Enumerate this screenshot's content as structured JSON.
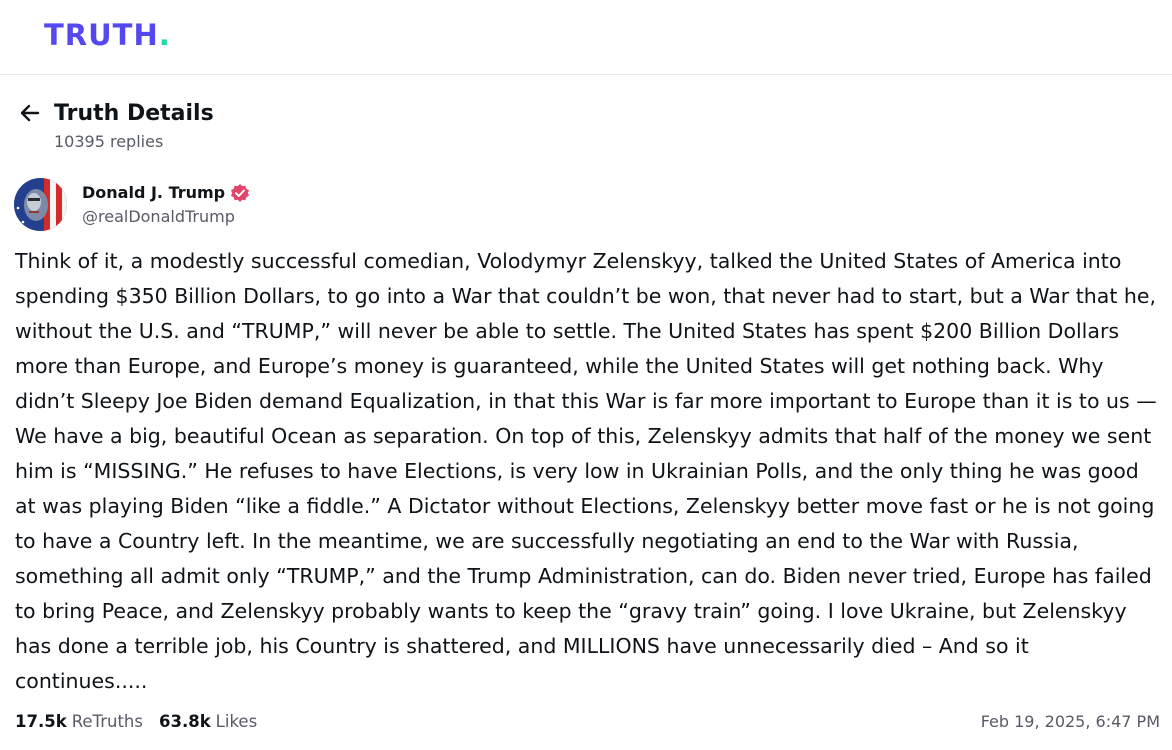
{
  "brand": {
    "logo_text": "TRUTH",
    "logo_dot": ".",
    "primary_color": "#5448ee",
    "accent_color": "#1ddba5"
  },
  "header": {
    "back_icon": "arrow-left-icon",
    "title": "Truth Details",
    "reply_count": "10395 replies"
  },
  "post": {
    "author": {
      "name": "Donald J. Trump",
      "handle": "@realDonaldTrump",
      "verified_icon": "verified-badge-icon",
      "verified_color": "#e2436b"
    },
    "body": "Think of it, a modestly successful comedian, Volodymyr Zelenskyy, talked the United States of America into spending $350 Billion Dollars, to go into a War that couldn’t be won, that never had to start, but a War that he, without the U.S. and “TRUMP,” will never be able to settle. The United States has spent $200 Billion Dollars more than Europe, and Europe’s money is guaranteed, while the United States will get nothing back. Why didn’t Sleepy Joe Biden demand Equalization, in that this War is far more important to Europe than it is to us — We have a big, beautiful Ocean as separation. On top of this, Zelenskyy admits that half of the money we sent him is “MISSING.” He refuses to have Elections, is very low in Ukrainian Polls, and the only thing he was good at was playing Biden “like a fiddle.” A Dictator without Elections, Zelenskyy better move fast or he is not going to have a Country left. In the meantime, we are successfully negotiating an end to the War with Russia, something all admit only “TRUMP,” and the Trump Administration, can do. Biden never tried, Europe has failed to bring Peace, and Zelenskyy probably wants to keep the “gravy train” going. I love Ukraine, but Zelenskyy has done a terrible job, his Country is shattered, and MILLIONS have unnecessarily died – And so it continues.....",
    "stats": {
      "retruths_count": "17.5k",
      "retruths_label": "ReTruths",
      "likes_count": "63.8k",
      "likes_label": "Likes"
    },
    "timestamp": "Feb 19, 2025, 6:47 PM"
  }
}
